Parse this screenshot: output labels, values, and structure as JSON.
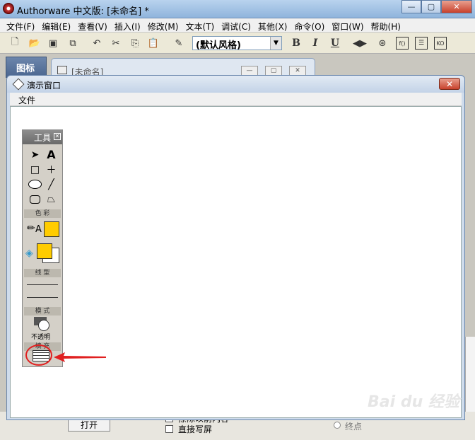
{
  "window": {
    "title": "Authorware 中文版: [未命名] *"
  },
  "menubar": [
    "文件(F)",
    "编辑(E)",
    "查看(V)",
    "插入(I)",
    "修改(M)",
    "文本(T)",
    "调试(C)",
    "其他(X)",
    "命令(O)",
    "窗口(W)",
    "帮助(H)"
  ],
  "toolbar": {
    "style_select": "(默认风格)",
    "bold": "B",
    "italic": "I",
    "underline": "U"
  },
  "icons_panel": {
    "title": "图标"
  },
  "design_window": {
    "title": "[未命名]"
  },
  "demo_window": {
    "title": "演示窗口",
    "menu_file": "文件"
  },
  "toolbox": {
    "title": "工具",
    "section_color": "色 彩",
    "section_line": "线 型",
    "section_mode": "模 式",
    "mode_label": "不透明",
    "section_fill": "填 充",
    "text_tool": "A",
    "text_color_glyph": "A"
  },
  "bottom_panel": {
    "open_button": "打开",
    "erase_checkbox": "擦除以前内容",
    "direct_checkbox": "直接写屏",
    "end_radio": "终点"
  },
  "watermark": "Bai du 经验",
  "colors": {
    "fill_yellow": "#ffcc00",
    "annotation_red": "#e02020"
  }
}
